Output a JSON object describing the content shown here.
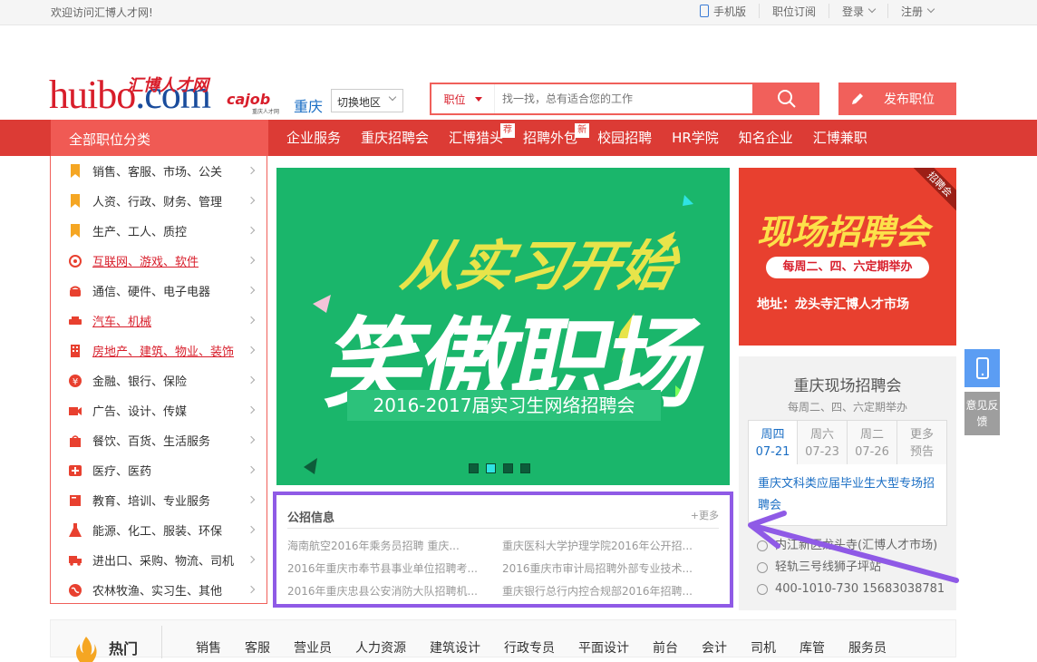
{
  "topbar": {
    "welcome": "欢迎访问汇博人才网!",
    "mobile": "手机版",
    "subscribe": "职位订阅",
    "login": "登录",
    "register": "注册"
  },
  "header": {
    "logo_main": "huibo",
    "logo_dot_com": ".com",
    "logo_cn": "汇博人才网",
    "cajob": "cajob",
    "cajob_sub": "重庆人才网",
    "city": "重庆",
    "switch_region": "切换地区",
    "search_category": "职位",
    "search_placeholder": "找一找，总有适合您的工作",
    "publish": "发布职位"
  },
  "nav": {
    "all_categories": "全部职位分类",
    "items": [
      {
        "label": "企业服务",
        "badge": ""
      },
      {
        "label": "重庆招聘会",
        "badge": ""
      },
      {
        "label": "汇博猎头",
        "badge": "荐"
      },
      {
        "label": "招聘外包",
        "badge": "新"
      },
      {
        "label": "校园招聘",
        "badge": ""
      },
      {
        "label": "HR学院",
        "badge": ""
      },
      {
        "label": "知名企业",
        "badge": ""
      },
      {
        "label": "汇博兼职",
        "badge": ""
      }
    ]
  },
  "sidebar": {
    "items": [
      {
        "label": "销售、客服、市场、公关",
        "icon": "bookmark-icon"
      },
      {
        "label": "人资、行政、财务、管理",
        "icon": "bookmark-icon"
      },
      {
        "label": "生产、工人、质控",
        "icon": "bookmark-icon"
      },
      {
        "label": "互联网、游戏、软件",
        "icon": "internet-icon"
      },
      {
        "label": "通信、硬件、电子电器",
        "icon": "phone-icon"
      },
      {
        "label": "汽车、机械",
        "icon": "car-icon"
      },
      {
        "label": "房地产、建筑、物业、装饰",
        "icon": "building-icon"
      },
      {
        "label": "金融、银行、保险",
        "icon": "yen-icon"
      },
      {
        "label": "广告、设计、传媒",
        "icon": "camera-icon"
      },
      {
        "label": "餐饮、百货、生活服务",
        "icon": "shopping-icon"
      },
      {
        "label": "医疗、医药",
        "icon": "medical-icon"
      },
      {
        "label": "教育、培训、专业服务",
        "icon": "book-icon"
      },
      {
        "label": "能源、化工、服装、环保",
        "icon": "flask-icon"
      },
      {
        "label": "进出口、采购、物流、司机",
        "icon": "truck-icon"
      },
      {
        "label": "农林牧渔、实习生、其他",
        "icon": "globe-icon"
      }
    ]
  },
  "banner": {
    "title1": "从实习开始",
    "title2": "笑傲职场",
    "subtitle": "2016-2017届实习生网络招聘会",
    "dots": 4,
    "active_dot": 1
  },
  "jobfair_ad": {
    "corner": "招聘会",
    "big": "现场招聘会",
    "schedule": "每周二、四、六定期举办",
    "address": "地址：龙头寺汇博人才市场"
  },
  "fair_panel": {
    "title": "重庆现场招聘会",
    "subtitle": "每周二、四、六定期举办",
    "tabs": [
      {
        "day": "周四",
        "date": "07-21"
      },
      {
        "day": "周六",
        "date": "07-23"
      },
      {
        "day": "周二",
        "date": "07-26"
      },
      {
        "day": "更多",
        "date": "预告"
      }
    ],
    "event": "重庆文科类应届毕业生大型专场招聘会",
    "info": [
      "内江新区龙头寺(汇博人才市场)",
      "轻轨三号线狮子坪站",
      "400-1010-730 15683038781"
    ]
  },
  "public_info": {
    "header": "公招信息",
    "more": "+更多",
    "items": [
      "海南航空2016年乘务员招聘 重庆...",
      "重庆医科大学护理学院2016年公开招...",
      "2016年重庆市奉节县事业单位招聘考...",
      "2016重庆市审计局招聘外部专业技术...",
      "2016年重庆忠县公安消防大队招聘机...",
      "重庆银行总行内控合规部2016年招聘..."
    ]
  },
  "float": {
    "feedback": "意见反馈"
  },
  "hot": {
    "label": "热门",
    "keywords": [
      "销售",
      "客服",
      "营业员",
      "人力资源",
      "建筑设计",
      "行政专员",
      "平面设计",
      "前台",
      "会计",
      "司机",
      "库管",
      "服务员"
    ]
  },
  "colors": {
    "brand_red": "#dc3b35",
    "accent_red": "#f1605b",
    "link_blue": "#1a6ec4",
    "banner_green": "#1ab66b",
    "annotation_purple": "#8f5ae6"
  }
}
